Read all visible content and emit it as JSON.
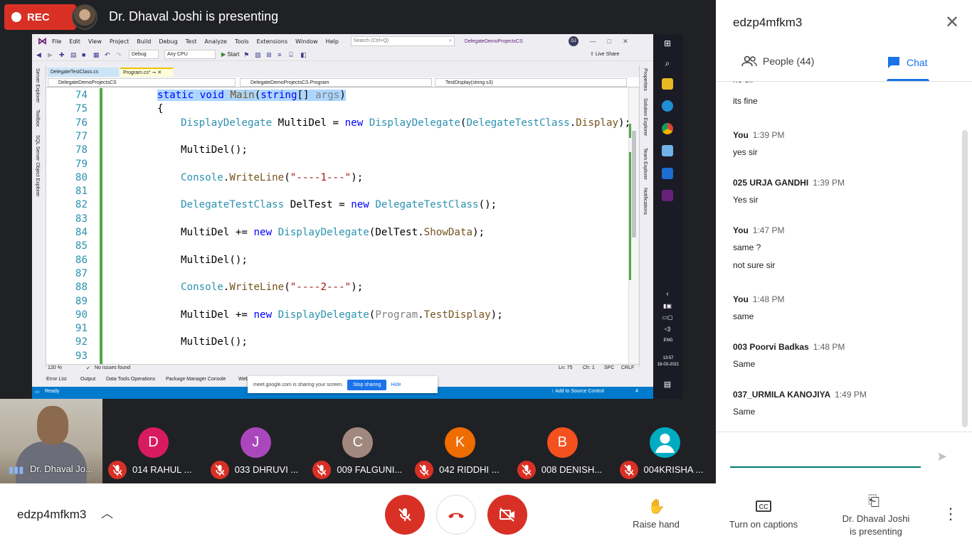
{
  "meet": {
    "rec_label": "REC",
    "presenter_title": "Dr. Dhaval Joshi is presenting",
    "meeting_code": "edzp4mfkm3"
  },
  "vs": {
    "menu": [
      "File",
      "Edit",
      "View",
      "Project",
      "Build",
      "Debug",
      "Test",
      "Analyze",
      "Tools",
      "Extensions",
      "Window",
      "Help"
    ],
    "search_placeholder": "Search (Ctrl+Q)",
    "solution_title": "DelegateDemoProjectsCS",
    "user_initials": "DJ",
    "config": "Debug",
    "platform": "Any CPU",
    "start_label": "Start",
    "live_share": "Live Share",
    "tabs": [
      "DelegateTestClass.cs",
      "Program.cs*"
    ],
    "nav": [
      "DelegateDemoProjectsCS",
      "DelegateDemoProjectsCS.Program",
      "TestDisplay(string s3)"
    ],
    "left_rail": [
      "Server Explorer",
      "Toolbox",
      "SQL Server Object Explorer"
    ],
    "right_rail": [
      "Properties",
      "Solution Explorer",
      "Team Explorer",
      "Notifications"
    ],
    "zoom": "120 %",
    "issues": "No issues found",
    "ln": "Ln: 75",
    "ch": "Ch: 1",
    "spc": "SPC",
    "crlf": "CRLF",
    "bottom_tabs": [
      "Error List",
      "Output",
      "Data Tools Operations",
      "Package Manager Console",
      "Web P"
    ],
    "status_ready": "Ready",
    "add_source": "Add to Source Control",
    "notif_count": "4",
    "share_text": "meet.google.com is sharing your screen.",
    "stop_sharing": "Stop sharing",
    "hide": "Hide",
    "clock_time": "13:57",
    "clock_date": "18-03-2021",
    "lang": "ENG"
  },
  "code": [
    {
      "n": "74",
      "parts": [
        [
          "kw",
          "static "
        ],
        [
          "kw",
          "void "
        ],
        [
          "mt",
          "Main"
        ],
        [
          "",
          "("
        ],
        [
          "kw",
          "string"
        ],
        [
          "",
          "[] "
        ],
        [
          "pm",
          "args"
        ],
        [
          "",
          ")"
        ]
      ],
      "selected": true,
      "indent": 0
    },
    {
      "n": "75",
      "parts": [
        [
          "",
          "{"
        ]
      ],
      "indent": 0
    },
    {
      "n": "76",
      "parts": [
        [
          "ty",
          "DisplayDelegate"
        ],
        [
          "",
          " MultiDel = "
        ],
        [
          "kw",
          "new "
        ],
        [
          "ty",
          "DisplayDelegate"
        ],
        [
          "",
          "("
        ],
        [
          "ty",
          "DelegateTestClass"
        ],
        [
          "",
          "."
        ],
        [
          "mt",
          "Display"
        ],
        [
          "",
          ");"
        ]
      ],
      "indent": 1
    },
    {
      "n": "77",
      "parts": [],
      "indent": 1
    },
    {
      "n": "78",
      "parts": [
        [
          "",
          "MultiDel();"
        ]
      ],
      "indent": 1
    },
    {
      "n": "79",
      "parts": [],
      "indent": 1
    },
    {
      "n": "80",
      "parts": [
        [
          "ty",
          "Console"
        ],
        [
          "",
          "."
        ],
        [
          "mt",
          "WriteLine"
        ],
        [
          "",
          "("
        ],
        [
          "st",
          "\"----1---\""
        ],
        [
          "",
          ");"
        ]
      ],
      "indent": 1
    },
    {
      "n": "81",
      "parts": [],
      "indent": 1
    },
    {
      "n": "82",
      "parts": [
        [
          "ty",
          "DelegateTestClass"
        ],
        [
          "",
          " DelTest = "
        ],
        [
          "kw",
          "new "
        ],
        [
          "ty",
          "DelegateTestClass"
        ],
        [
          "",
          "();"
        ]
      ],
      "indent": 1
    },
    {
      "n": "83",
      "parts": [],
      "indent": 1
    },
    {
      "n": "84",
      "parts": [
        [
          "",
          "MultiDel += "
        ],
        [
          "kw",
          "new "
        ],
        [
          "ty",
          "DisplayDelegate"
        ],
        [
          "",
          "(DelTest."
        ],
        [
          "mt",
          "ShowData"
        ],
        [
          "",
          ");"
        ]
      ],
      "indent": 1
    },
    {
      "n": "85",
      "parts": [],
      "indent": 1
    },
    {
      "n": "86",
      "parts": [
        [
          "",
          "MultiDel();"
        ]
      ],
      "indent": 1
    },
    {
      "n": "87",
      "parts": [],
      "indent": 1
    },
    {
      "n": "88",
      "parts": [
        [
          "ty",
          "Console"
        ],
        [
          "",
          "."
        ],
        [
          "mt",
          "WriteLine"
        ],
        [
          "",
          "("
        ],
        [
          "st",
          "\"----2---\""
        ],
        [
          "",
          ");"
        ]
      ],
      "indent": 1
    },
    {
      "n": "89",
      "parts": [],
      "indent": 1
    },
    {
      "n": "90",
      "parts": [
        [
          "",
          "MultiDel += "
        ],
        [
          "kw",
          "new "
        ],
        [
          "ty",
          "DisplayDelegate"
        ],
        [
          "",
          "("
        ],
        [
          "pm",
          "Program"
        ],
        [
          "",
          "."
        ],
        [
          "mt",
          "TestDisplay"
        ],
        [
          "",
          ");"
        ]
      ],
      "indent": 1
    },
    {
      "n": "91",
      "parts": [],
      "indent": 1
    },
    {
      "n": "92",
      "parts": [
        [
          "",
          "MultiDel();"
        ]
      ],
      "indent": 1
    },
    {
      "n": "93",
      "parts": [],
      "indent": 1
    }
  ],
  "participants": {
    "self_name": "Dr. Dhaval Jo...",
    "tiles": [
      {
        "initial": "D",
        "color": "#d81b60",
        "name": "014 RAHUL ..."
      },
      {
        "initial": "J",
        "color": "#ab47bc",
        "name": "033 DHRUVI ..."
      },
      {
        "initial": "C",
        "color": "#a1887f",
        "name": "009 FALGUNI..."
      },
      {
        "initial": "K",
        "color": "#ef6c00",
        "name": "042 RIDDHI ..."
      },
      {
        "initial": "B",
        "color": "#f4511e",
        "name": "008 DENISH..."
      },
      {
        "initial": "",
        "color": "#00acc1",
        "name": "004KRISHA ..."
      }
    ]
  },
  "panel": {
    "title": "edzp4mfkm3",
    "people_label": "People (44)",
    "chat_label": "Chat",
    "messages": [
      {
        "sender": "",
        "time": "",
        "text": "no sir",
        "cut": true
      },
      {
        "sender": "",
        "time": "",
        "text": "its fine"
      },
      {
        "sender": "You",
        "time": "1:39 PM",
        "text": "yes sir"
      },
      {
        "sender": "025 URJA GANDHI",
        "time": "1:39 PM",
        "text": "Yes sir"
      },
      {
        "sender": "You",
        "time": "1:47 PM",
        "text": "same ?"
      },
      {
        "sender": "",
        "time": "",
        "text": "not sure sir"
      },
      {
        "sender": "You",
        "time": "1:48 PM",
        "text": "same"
      },
      {
        "sender": "003 Poorvi Badkas",
        "time": "1:48 PM",
        "text": "Same"
      },
      {
        "sender": "037_URMILA KANOJIYA",
        "time": "1:49 PM",
        "text": "Same"
      }
    ]
  },
  "controls": {
    "raise_hand": "Raise hand",
    "captions": "Turn on captions",
    "presenting_line1": "Dr. Dhaval Joshi",
    "presenting_line2": "is presenting"
  }
}
